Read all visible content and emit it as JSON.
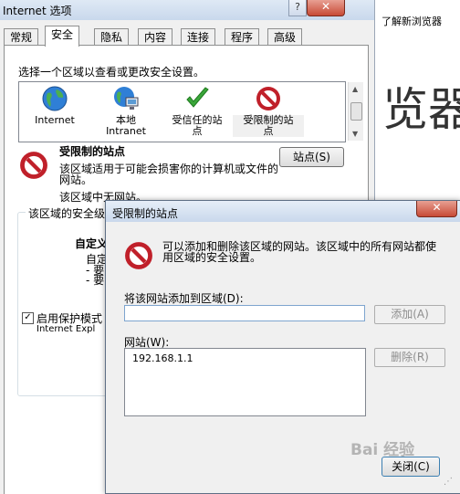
{
  "main_window": {
    "title": "Internet 选项",
    "help_button": "?",
    "close_button": "✕",
    "tabs": [
      {
        "label": "常规"
      },
      {
        "label": "安全"
      },
      {
        "label": "隐私"
      },
      {
        "label": "内容"
      },
      {
        "label": "连接"
      },
      {
        "label": "程序"
      },
      {
        "label": "高级"
      }
    ],
    "active_tab": "安全",
    "zone_instruction": "选择一个区域以查看或更改安全设置。",
    "zones": [
      {
        "label_line1": "Internet",
        "label_line2": "",
        "icon": "globe-icon"
      },
      {
        "label_line1": "本地",
        "label_line2": "Intranet",
        "icon": "intranet-globe-icon"
      },
      {
        "label_line1": "受信任的站",
        "label_line2": "点",
        "icon": "check-icon"
      },
      {
        "label_line1": "受限制的站",
        "label_line2": "点",
        "icon": "no-entry-icon"
      }
    ],
    "selected_zone": "受限制的站点",
    "sites_button": "站点(S)",
    "zone_desc": "该区域适用于可能会损害你的计算机或文件的网站。",
    "zone_no_sites": "该区域中无网站。",
    "security_group_label": "该区域的安全级",
    "custom_level_title": "自定义",
    "custom_level_line1": "自定",
    "custom_dash1": "- 要",
    "custom_dash2": "- 要",
    "protected_checkbox_mark": "✓",
    "protected_mode_label": "启用保护模式",
    "protected_mode_sub": "Internet Expl"
  },
  "background_page": {
    "tab_title": "了解新浏览器",
    "headline": "览器"
  },
  "dialog": {
    "title": "受限制的站点",
    "close_button": "✕",
    "description": "可以添加和删除该区域的网站。该区域中的所有网站都使用区域的安全设置。",
    "add_label": "将该网站添加到区域(D):",
    "add_input_value": "",
    "add_button": "添加(A)",
    "websites_label": "网站(W):",
    "websites": [
      "192.168.1.1"
    ],
    "remove_button": "删除(R)",
    "close_dialog_button": "关闭(C)"
  },
  "watermark": "Bai 经验",
  "colors": {
    "close_red": "#c74a36",
    "title_blue": "#c9d8ec",
    "check_green": "#3aa63a",
    "no_entry_red": "#c0202a"
  }
}
